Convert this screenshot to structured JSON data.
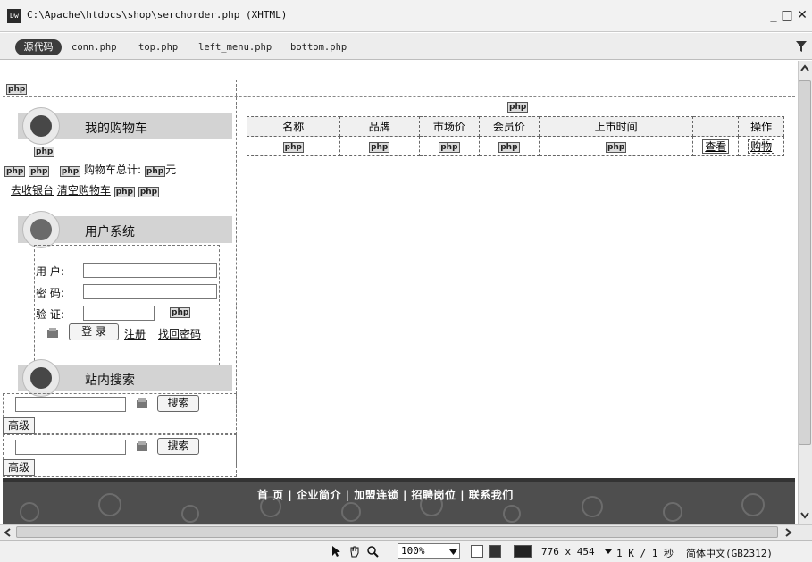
{
  "window": {
    "app_icon": "Dw",
    "title": "C:\\Apache\\htdocs\\shop\\serchorder.php (XHTML)",
    "minimize": "_",
    "maximize": "□",
    "close": "✕"
  },
  "filebar": {
    "source_label": "源代码",
    "files": [
      "conn.php",
      "top.php",
      "left_menu.php",
      "bottom.php"
    ],
    "filter_icon": "filter-icon"
  },
  "php_tag": "php",
  "left": {
    "cart_title": "我的购物车",
    "cart_total_label": "购物车总计:",
    "cart_unit": "元",
    "checkout_link": "去收银台",
    "clear_link": "清空购物车",
    "user_title": "用户系统",
    "username_label": "用 户:",
    "password_label": "密 码:",
    "verify_label": "验 证:",
    "login_button": "登 录",
    "register_link": "注册",
    "recover_link": "找回密码",
    "search_title": "站内搜索",
    "search_button": "搜索",
    "advanced_button": "高级",
    "search_button_2": "搜索",
    "advanced_button_2": "高级"
  },
  "table": {
    "headers": [
      "名称",
      "品牌",
      "市场价",
      "会员价",
      "上市时间",
      "",
      "操作"
    ],
    "view_link": "查看",
    "buy_link": "购物"
  },
  "footer": {
    "nav": [
      "首 页",
      "企业简介",
      "加盟连锁",
      "招聘岗位",
      "联系我们"
    ],
    "separator": "|"
  },
  "status": {
    "zoom": "100%",
    "size": "776 x 454",
    "download": "1 K / 1 秒",
    "encoding": "简体中文(GB2312)"
  },
  "colors": {
    "footer_band": "#4e4e4e",
    "section_header": "#d3d3d3"
  }
}
